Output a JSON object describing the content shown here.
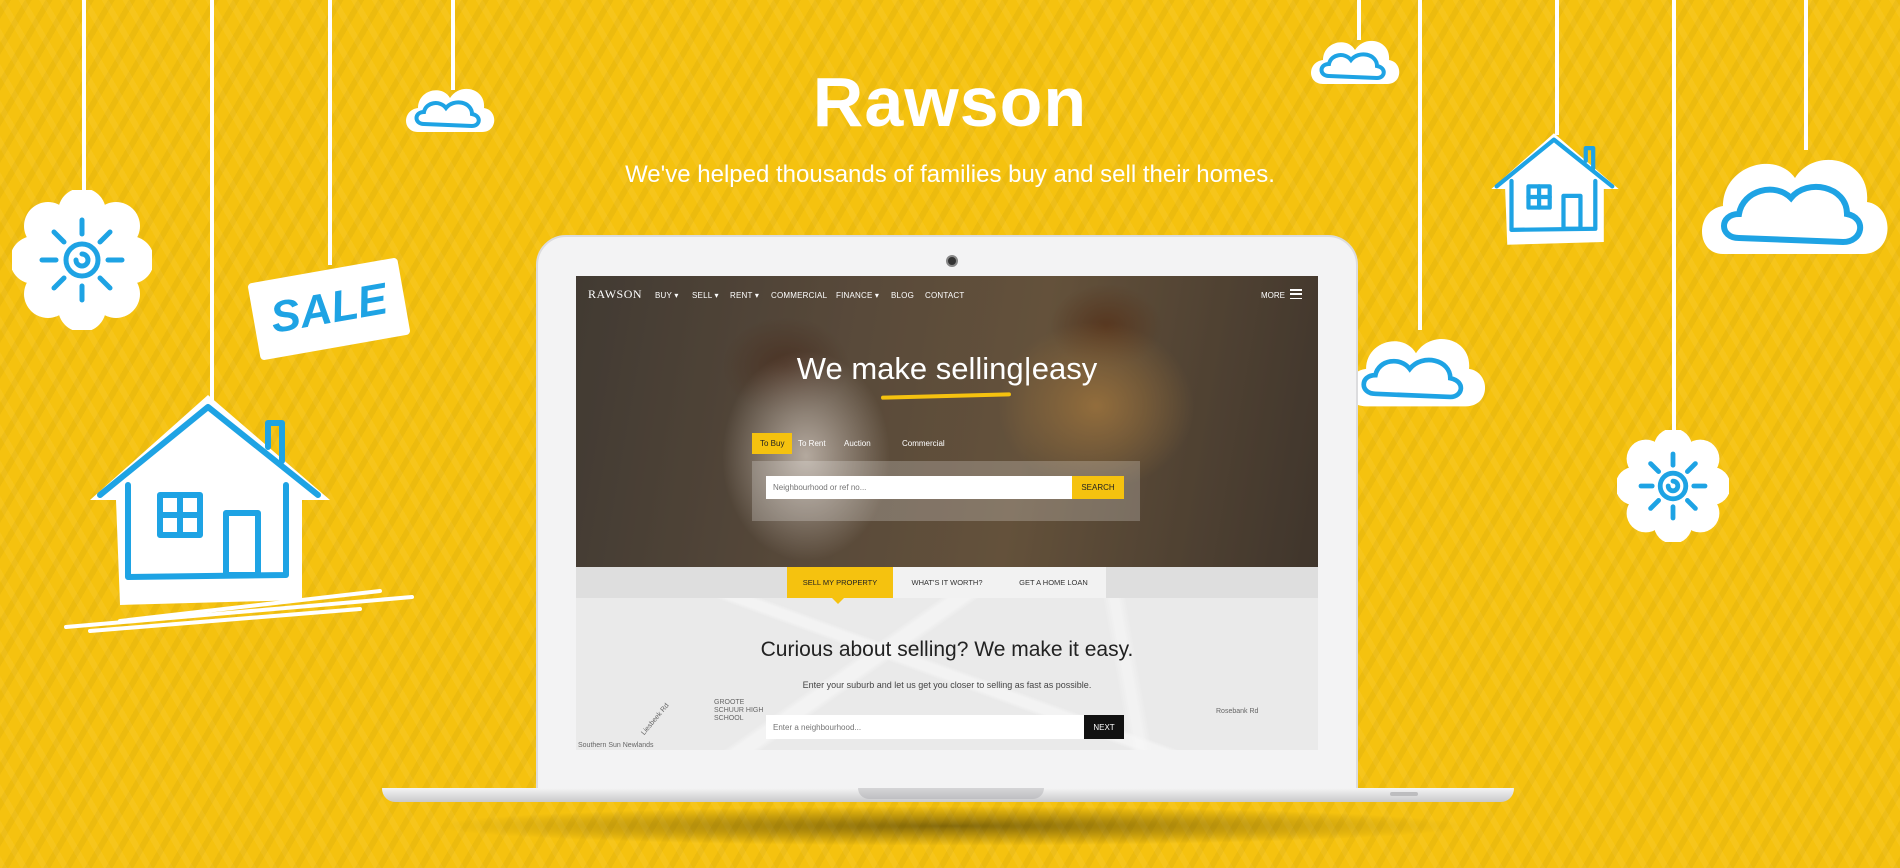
{
  "brand": {
    "title": "Rawson",
    "tagline": "We've helped thousands of families buy and sell their homes.",
    "accent_color": "#f5c20f"
  },
  "decor": {
    "sale_sign": "SALE"
  },
  "site": {
    "logo": "RAWSON",
    "nav": [
      {
        "label": "BUY ▾"
      },
      {
        "label": "SELL ▾"
      },
      {
        "label": "RENT ▾"
      },
      {
        "label": "COMMERCIAL"
      },
      {
        "label": "FINANCE ▾"
      },
      {
        "label": "BLOG"
      },
      {
        "label": "CONTACT"
      }
    ],
    "more_label": "MORE",
    "headline_pre": "We make selling",
    "headline_post": "easy",
    "search_tabs": [
      {
        "label": "To Buy"
      },
      {
        "label": "To Rent"
      },
      {
        "label": "Auction"
      },
      {
        "label": "Commercial"
      }
    ],
    "search_placeholder": "Neighbourhood or ref no...",
    "search_button": "SEARCH",
    "sub_tabs": [
      {
        "label": "SELL MY PROPERTY"
      },
      {
        "label": "WHAT'S IT WORTH?"
      },
      {
        "label": "GET A HOME LOAN"
      }
    ],
    "curious_title": "Curious about selling? We make it easy.",
    "curious_sub": "Enter your suburb and let us get you closer to selling as fast as possible.",
    "neighbourhood_placeholder": "Enter a neighbourhood...",
    "next_button": "NEXT",
    "map_labels": [
      "GROOTE SCHUUR HIGH SCHOOL",
      "Southern Sun Newlands",
      "Rosebank Rd",
      "Liesbeek Rd"
    ]
  }
}
